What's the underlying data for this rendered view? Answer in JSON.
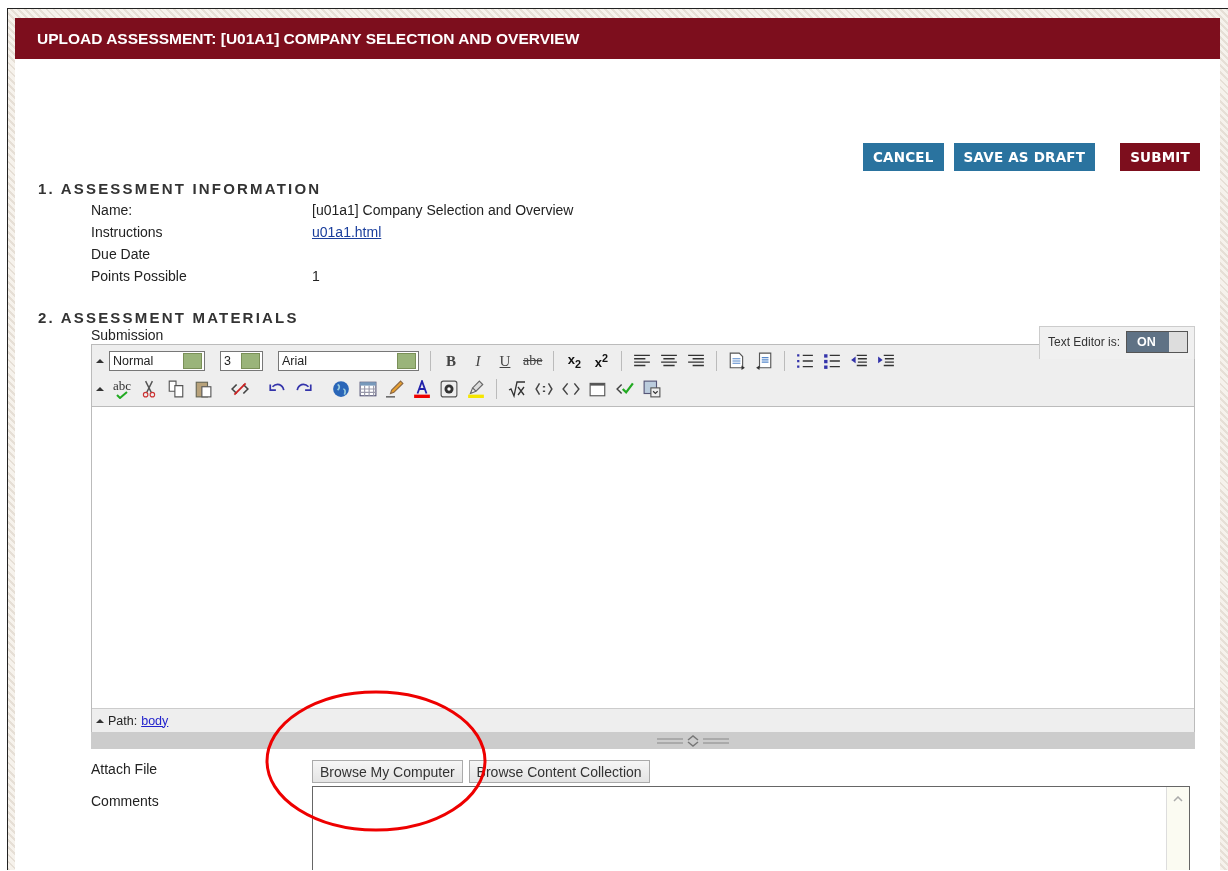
{
  "header": {
    "title": "UPLOAD ASSESSMENT: [U01A1] COMPANY SELECTION AND OVERVIEW"
  },
  "actions": [
    {
      "label": "CANCEL",
      "kind": "secondary"
    },
    {
      "label": "SAVE AS DRAFT",
      "kind": "secondary"
    },
    {
      "label": "SUBMIT",
      "kind": "primary"
    }
  ],
  "info": {
    "heading": "1. ASSESSMENT INFORMATION",
    "rows": [
      {
        "label": "Name:",
        "value": "[u01a1] Company Selection and Overview",
        "kind": "text"
      },
      {
        "label": "Instructions",
        "value": "u01a1.html",
        "kind": "link"
      },
      {
        "label": "Due Date",
        "kind": "text"
      },
      {
        "label": "Points Possible",
        "value": "1",
        "kind": "text"
      }
    ]
  },
  "materials": {
    "heading": "2. ASSESSMENT MATERIALS",
    "submission_label": "Submission",
    "editor": {
      "toggle_label": "Text Editor is:",
      "toggle_state": "ON",
      "on": true,
      "selects": [
        "Normal",
        "3",
        "Arial"
      ],
      "glyphs": [
        "B",
        "I",
        "U",
        "abe",
        "x$_{2}$",
        "x$^{2}$"
      ],
      "spell_label": "abc",
      "path_label": "Path:",
      "path_link": "body"
    },
    "attach_label": "Attach File",
    "attach_buttons": [
      "Browse My Computer",
      "Browse Content Collection"
    ],
    "comments_label": "Comments"
  }
}
